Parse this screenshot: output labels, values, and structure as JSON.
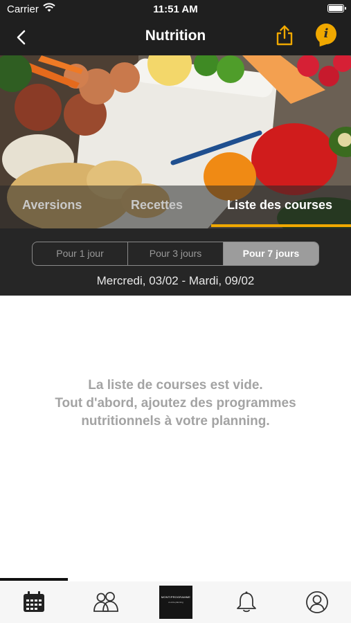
{
  "status_bar": {
    "carrier": "Carrier",
    "time": "11:51 AM"
  },
  "nav": {
    "title": "Nutrition",
    "info_glyph": "i"
  },
  "tabs": [
    {
      "label": "Aversions",
      "active": false
    },
    {
      "label": "Recettes",
      "active": false
    },
    {
      "label": "Liste des courses",
      "active": true
    }
  ],
  "segments": [
    {
      "label": "Pour 1 jour",
      "active": false
    },
    {
      "label": "Pour 3 jours",
      "active": false
    },
    {
      "label": "Pour 7 jours",
      "active": true
    }
  ],
  "date_range": "Mercredi, 03/02 - Mardi, 09/02",
  "empty_state": {
    "line1": "La liste de courses est vide.",
    "line2": "Tout d'abord, ajoutez des programmes",
    "line3": "nutritionnels à votre planning."
  },
  "tab_bar": {
    "items": [
      "calendar-icon",
      "group-icon",
      "brand-logo",
      "bell-icon",
      "profile-icon"
    ],
    "logo_text": "MONTIPROGRAMME",
    "logo_subtext": "à votre planning"
  },
  "colors": {
    "accent": "#f0a800",
    "dark": "#1f1f1f"
  }
}
